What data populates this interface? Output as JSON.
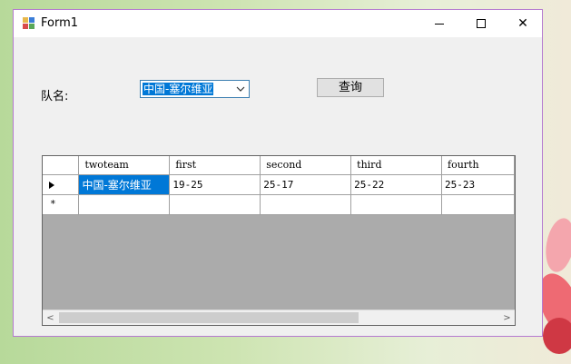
{
  "window": {
    "title": "Form1",
    "minimize_icon": "minimize-icon",
    "maximize_icon": "maximize-icon",
    "close_label": "✕"
  },
  "form": {
    "team_label": "队名:",
    "team_selected": "中国-塞尔维亚",
    "query_label": "查询"
  },
  "grid": {
    "columns": [
      "twoteam",
      "first",
      "second",
      "third",
      "fourth"
    ],
    "rows": [
      [
        "中国-塞尔维亚",
        "19-25",
        "25-17",
        "25-22",
        "25-23"
      ]
    ],
    "new_row_marker": "*",
    "scroll_left": "<",
    "scroll_right": ">"
  }
}
